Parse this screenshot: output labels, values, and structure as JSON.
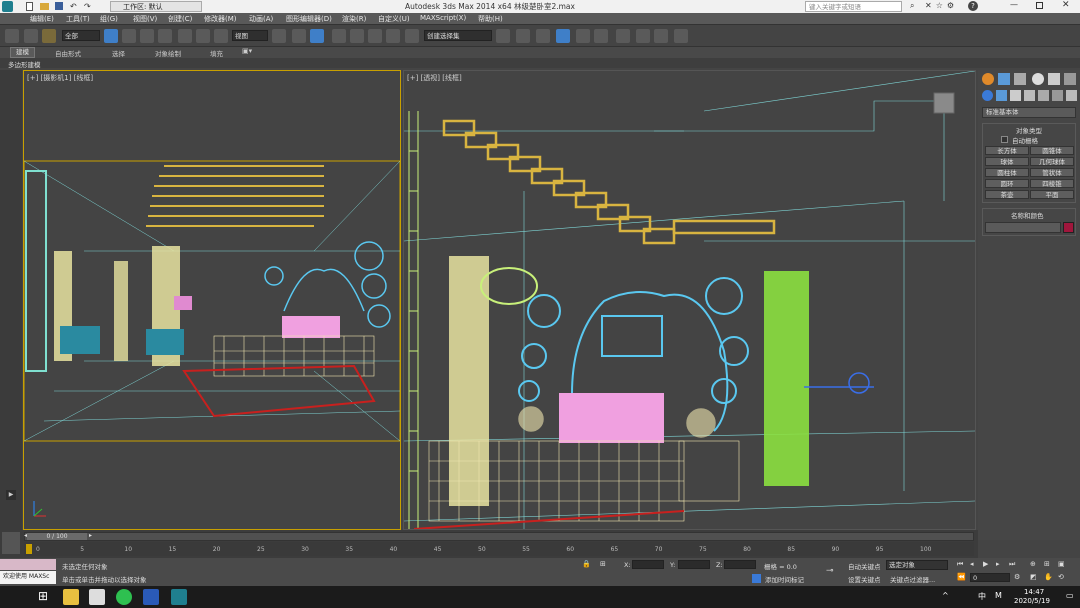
{
  "title_bar": {
    "title": "Autodesk 3ds Max  2014 x64     林级楚卧室2.max",
    "workspace": "工作区: 默认",
    "search_placeholder": "键入关键字或短语"
  },
  "menu": [
    "编辑(E)",
    "工具(T)",
    "组(G)",
    "视图(V)",
    "创建(C)",
    "修改器(M)",
    "动画(A)",
    "图形编辑器(D)",
    "渲染(R)",
    "自定义(U)",
    "MAXScript(X)",
    "帮助(H)"
  ],
  "toolbar": {
    "selection_filter": "全部",
    "ref_coord": "视图",
    "named_selection": "创建选择集"
  },
  "ribbon_tabs": [
    "建模",
    "自由形式",
    "选择",
    "对象绘制",
    "填充"
  ],
  "ribbon_sub": "多边形建模",
  "viewports": {
    "left_label": "[+] [摄影机1] [线框]",
    "right_label": "[+] [透视] [线框]"
  },
  "command_panel": {
    "dropdown": "标准基本体",
    "object_type_title": "对象类型",
    "autogrid": "自动栅格",
    "buttons": [
      "长方体",
      "圆锥体",
      "球体",
      "几何球体",
      "圆柱体",
      "管状体",
      "圆环",
      "四棱锥",
      "茶壶",
      "平面"
    ],
    "name_color_title": "名称和颜色",
    "object_color": "#a0163c"
  },
  "trackbar": {
    "frame": "0 / 100",
    "ticks": [
      "0",
      "5",
      "10",
      "15",
      "20",
      "25",
      "30",
      "35",
      "40",
      "45",
      "50",
      "55",
      "60",
      "65",
      "70",
      "75",
      "80",
      "85",
      "90",
      "95",
      "100"
    ]
  },
  "status": {
    "welcome": "欢迎使用 MAXSc",
    "line1": "未选定任何对象",
    "line2": "单击或单击并拖动以选择对象",
    "x_label": "X:",
    "y_label": "Y:",
    "z_label": "Z:",
    "grid": "栅格 = 0.0",
    "add_time_tag": "添加时间标记",
    "auto_key": "自动关键点",
    "selected": "选定对象",
    "set_key": "设置关键点",
    "key_filters": "关键点过滤器...",
    "frame_field": "0"
  },
  "taskbar": {
    "time": "14:47",
    "date": "2020/5/19",
    "ime": "中",
    "ime2": "M"
  }
}
